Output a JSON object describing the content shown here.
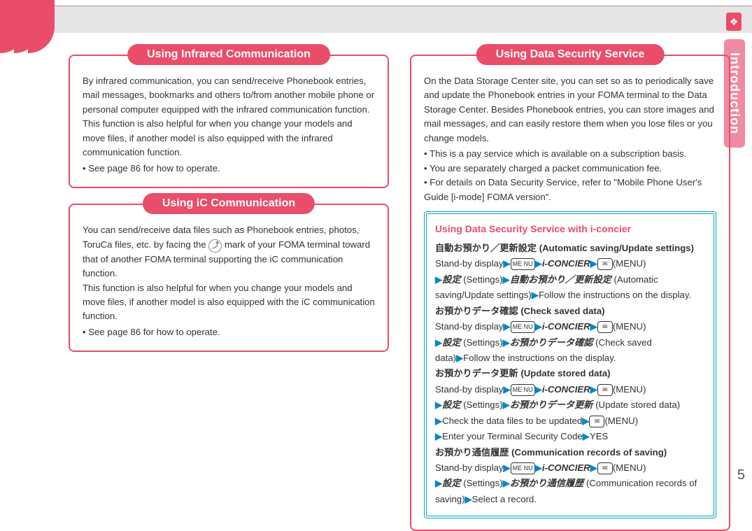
{
  "page": {
    "number": "5",
    "tab": "Introduction",
    "bookmark_icon": "❖"
  },
  "left": {
    "ir": {
      "title": "Using Infrared Communication",
      "p1": "By infrared communication, you can send/receive Phonebook entries, mail messages, bookmarks and others to/from another mobile phone or personal computer equipped with the infrared communication function.",
      "p2": "This function is also helpful for when you change your models and move files, if another model is also equipped with the infrared communication function.",
      "b1": "See page 86 for how to operate."
    },
    "ic": {
      "title": "Using iC Communication",
      "p1a": "You can send/receive data files such as Phonebook entries, photos, ToruCa files, etc. by facing the ",
      "fxmark": "⤴",
      "p1b": " mark of your FOMA terminal toward that of another FOMA terminal supporting the iC communication function.",
      "p2": "This function is also helpful for when you change your models and move files, if another model is also equipped with the iC communication function.",
      "b1": "See page 86 for how to operate."
    }
  },
  "right": {
    "dss": {
      "title": "Using Data Security Service",
      "p1": "On the Data Storage Center site, you can set so as to periodically save and update the Phonebook entries in your FOMA terminal to the Data Storage Center. Besides Phonebook entries, you can store images and mail messages, and can easily restore them when you lose files or you change models.",
      "b1": "This is a pay service which is available on a subscription basis.",
      "b2": "You are separately charged a packet communication fee.",
      "b3": "For details on Data Security Service, refer to \"Mobile Phone User's Guide [i-mode] FOMA version\"."
    },
    "iconcier": {
      "title": "Using Data Security Service with i-concier",
      "txt": {
        "standby": "Stand-by display",
        "menu_btn": "ME\nNU",
        "iconcier": "i-CONCIER",
        "mail_btn": "✉",
        "menu_lbl": "(MENU)",
        "settings_jp": "設定",
        "settings_en": " (Settings)",
        "follow": "Follow the instructions on the display.",
        "yes": "YES"
      },
      "s1": {
        "head": "自動お預かり／更新設定 (Automatic saving/Update settings)",
        "act_jp": "自動お預かり／更新設定",
        "act_en": " (Automatic saving/Update settings)"
      },
      "s2": {
        "head": "お預かりデータ確認 (Check saved data)",
        "act_jp": "お預かりデータ確認",
        "act_en": " (Check saved data)"
      },
      "s3": {
        "head": "お預かりデータ更新 (Update stored data)",
        "act_jp": "お預かりデータ更新",
        "act_en": " (Update stored data)",
        "step2": "Check the data files to be updated",
        "step3": "Enter your Terminal Security Code"
      },
      "s4": {
        "head": "お預かり通信履歴 (Communication records of saving)",
        "act_jp": "お預かり通信履歴",
        "act_en": " (Communication records of saving)",
        "step2": "Select a record."
      }
    }
  }
}
